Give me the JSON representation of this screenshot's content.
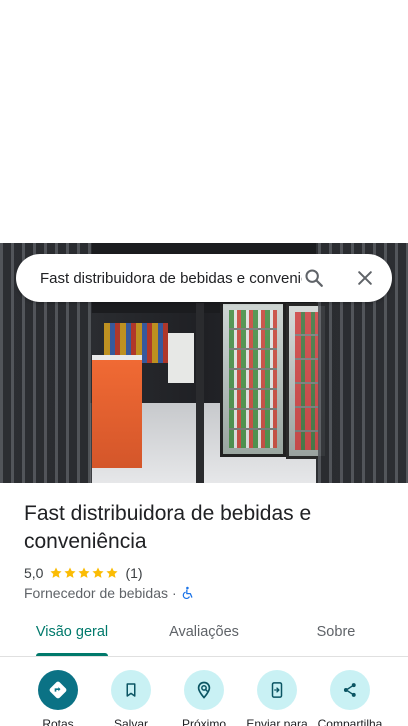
{
  "search": {
    "query": "Fast distribuidora de bebidas e conveniência"
  },
  "place": {
    "name": "Fast distribuidora de bebidas e conveniência",
    "rating": "5,0",
    "stars_filled": 5,
    "review_count": "(1)",
    "category": "Fornecedor de bebidas",
    "separator": "·"
  },
  "tabs": [
    {
      "label": "Visão geral",
      "active": true
    },
    {
      "label": "Avaliações",
      "active": false
    },
    {
      "label": "Sobre",
      "active": false
    }
  ],
  "actions": [
    {
      "label": "Rotas",
      "icon": "directions-icon"
    },
    {
      "label": "Salvar",
      "icon": "bookmark-icon"
    },
    {
      "label": "Próximo",
      "icon": "nearby-icon"
    },
    {
      "label": "Enviar para",
      "icon": "send-to-phone-icon"
    },
    {
      "label": "Compartilha",
      "icon": "share-icon"
    }
  ],
  "colors": {
    "accent": "#00796b",
    "action_bg": "#c9f1f4",
    "primary_action_bg": "#0b7285",
    "star": "#fbbc04"
  }
}
